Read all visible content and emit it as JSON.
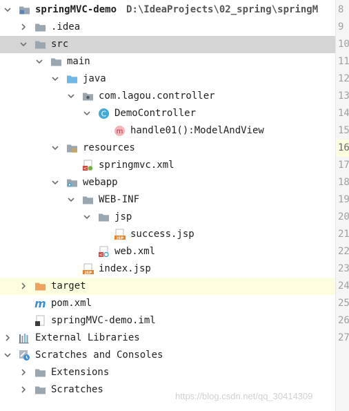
{
  "project": {
    "name": "springMVC-demo",
    "path": "D:\\IdeaProjects\\02_spring\\springM"
  },
  "tree": [
    {
      "label": "springMVC-demo",
      "indent": 0,
      "arrow": "down",
      "icon": "project-folder-icon",
      "highlight": "none",
      "bold": true,
      "has_path": true
    },
    {
      "label": ".idea",
      "indent": 1,
      "arrow": "right",
      "icon": "folder-icon",
      "highlight": "none"
    },
    {
      "label": "src",
      "indent": 1,
      "arrow": "down",
      "icon": "folder-icon",
      "highlight": "gray"
    },
    {
      "label": "main",
      "indent": 2,
      "arrow": "down",
      "icon": "folder-icon",
      "highlight": "none"
    },
    {
      "label": "java",
      "indent": 3,
      "arrow": "down",
      "icon": "source-folder-icon",
      "highlight": "none"
    },
    {
      "label": "com.lagou.controller",
      "indent": 4,
      "arrow": "down",
      "icon": "package-icon",
      "highlight": "none"
    },
    {
      "label": "DemoController",
      "indent": 5,
      "arrow": "down",
      "icon": "class-icon",
      "highlight": "none"
    },
    {
      "label": "handle01():ModelAndView",
      "indent": 6,
      "arrow": "none",
      "icon": "method-icon",
      "highlight": "none"
    },
    {
      "label": "resources",
      "indent": 3,
      "arrow": "down",
      "icon": "resources-folder-icon",
      "highlight": "none"
    },
    {
      "label": "springmvc.xml",
      "indent": 4,
      "arrow": "none",
      "icon": "spring-xml-icon",
      "highlight": "none"
    },
    {
      "label": "webapp",
      "indent": 3,
      "arrow": "down",
      "icon": "web-folder-icon",
      "highlight": "none"
    },
    {
      "label": "WEB-INF",
      "indent": 4,
      "arrow": "down",
      "icon": "folder-icon",
      "highlight": "none"
    },
    {
      "label": "jsp",
      "indent": 5,
      "arrow": "down",
      "icon": "folder-icon",
      "highlight": "none"
    },
    {
      "label": "success.jsp",
      "indent": 6,
      "arrow": "none",
      "icon": "jsp-file-icon",
      "highlight": "none"
    },
    {
      "label": "web.xml",
      "indent": 5,
      "arrow": "none",
      "icon": "web-xml-icon",
      "highlight": "none"
    },
    {
      "label": "index.jsp",
      "indent": 4,
      "arrow": "none",
      "icon": "jsp-file-icon",
      "highlight": "none"
    },
    {
      "label": "target",
      "indent": 1,
      "arrow": "right",
      "icon": "excluded-folder-icon",
      "highlight": "yellow"
    },
    {
      "label": "pom.xml",
      "indent": 1,
      "arrow": "none",
      "icon": "maven-icon",
      "highlight": "none"
    },
    {
      "label": "springMVC-demo.iml",
      "indent": 1,
      "arrow": "none",
      "icon": "iml-file-icon",
      "highlight": "none"
    },
    {
      "label": "External Libraries",
      "indent": 0,
      "arrow": "right",
      "icon": "libraries-icon",
      "highlight": "none"
    },
    {
      "label": "Scratches and Consoles",
      "indent": 0,
      "arrow": "down",
      "icon": "scratches-icon",
      "highlight": "none"
    },
    {
      "label": "Extensions",
      "indent": 1,
      "arrow": "right",
      "icon": "folder-icon",
      "highlight": "none"
    },
    {
      "label": "Scratches",
      "indent": 1,
      "arrow": "right",
      "icon": "folder-icon",
      "highlight": "none"
    }
  ],
  "gutter": {
    "line_numbers": [
      "8",
      "9",
      "10",
      "11",
      "12",
      "13",
      "14",
      "15",
      "16",
      "17",
      "18",
      "19",
      "20",
      "21",
      "22",
      "23",
      "24",
      "25",
      "26",
      "27"
    ],
    "current_line": "16"
  },
  "watermark": "https://blog.csdn.net/qq_30414309",
  "colors": {
    "selection_gray": "#d5d5d5",
    "caret_row_yellow": "#fdfde0",
    "folder": "#9aa7b0",
    "source_folder": "#6fb7e6",
    "excluded_folder": "#f0a35e",
    "class_icon": "#3fa9d8",
    "method_icon": "#f29aa0"
  }
}
